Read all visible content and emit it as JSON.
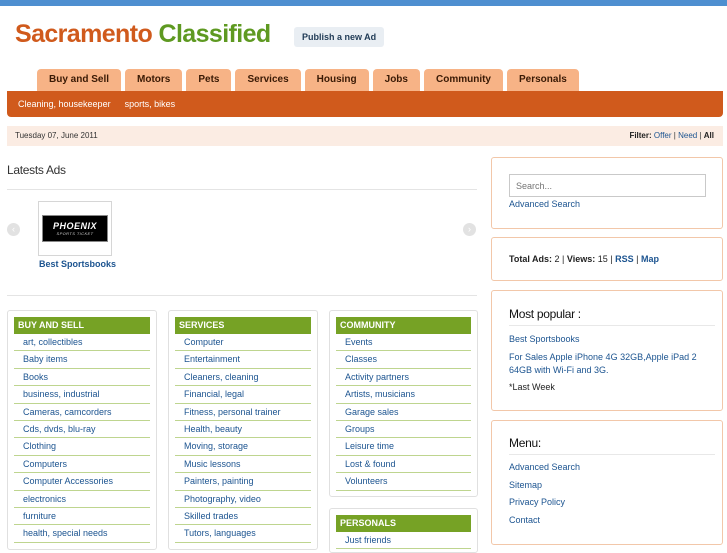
{
  "site": {
    "title_part1": "Sacramento",
    "title_part2": "Classified",
    "publish_label": "Publish a new Ad"
  },
  "nav": {
    "tabs": [
      {
        "label": "Buy and Sell"
      },
      {
        "label": "Motors"
      },
      {
        "label": "Pets"
      },
      {
        "label": "Services"
      },
      {
        "label": "Housing"
      },
      {
        "label": "Jobs"
      },
      {
        "label": "Community"
      },
      {
        "label": "Personals"
      }
    ],
    "subnav": [
      {
        "label": "Cleaning, housekeeper"
      },
      {
        "label": "sports, bikes"
      }
    ]
  },
  "datebar": {
    "date": "Tuesday 07, June 2011",
    "filter_label": "Filter:",
    "filter_offer": "Offer",
    "filter_need": "Need",
    "filter_all": "All",
    "sep": "|"
  },
  "latest": {
    "title": "Latests Ads",
    "ad_logo_main": "PHOENIX",
    "ad_logo_sub": "SPORTS TICKET",
    "ad_caption": "Best Sportsbooks"
  },
  "categories": {
    "buy_and_sell": {
      "header": "BUY AND SELL",
      "items": [
        "art, collectibles",
        "Baby items",
        "Books",
        "business, industrial",
        "Cameras, camcorders",
        "Cds, dvds, blu-ray",
        "Clothing",
        "Computers",
        "Computer Accessories",
        "electronics",
        "furniture",
        "health, special needs"
      ]
    },
    "services": {
      "header": "SERVICES",
      "items": [
        "Computer",
        "Entertainment",
        "Cleaners, cleaning",
        "Financial, legal",
        "Fitness, personal trainer",
        "Health, beauty",
        "Moving, storage",
        "Music lessons",
        "Painters, painting",
        "Photography, video",
        "Skilled trades",
        "Tutors, languages"
      ]
    },
    "community": {
      "header": "COMMUNITY",
      "items": [
        "Events",
        "Classes",
        "Activity partners",
        "Artists, musicians",
        "Garage sales",
        "Groups",
        "Leisure time",
        "Lost & found",
        "Volunteers"
      ]
    },
    "personals": {
      "header": "PERSONALS",
      "items": [
        "Just friends"
      ]
    }
  },
  "sidebar": {
    "search_placeholder": "Search...",
    "advanced_search": "Advanced Search",
    "stats_total_label": "Total Ads",
    "stats_total_value": "2",
    "stats_views_label": "Views",
    "stats_views_value": "15",
    "stats_rss": "RSS",
    "stats_map": "Map",
    "popular_title": "Most popular :",
    "popular_items": [
      "Best Sportsbooks",
      "For Sales Apple iPhone 4G 32GB,Apple iPad 2 64GB with Wi-Fi and 3G."
    ],
    "popular_note": "*Last Week",
    "menu_title": "Menu:",
    "menu_items": [
      "Advanced Search",
      "Sitemap",
      "Privacy Policy",
      "Contact"
    ]
  },
  "colors": {
    "brand_orange": "#d05a1c",
    "brand_green": "#5e9921",
    "tab_bg": "#f7b386",
    "category_header": "#76a225",
    "link": "#1c5490"
  }
}
